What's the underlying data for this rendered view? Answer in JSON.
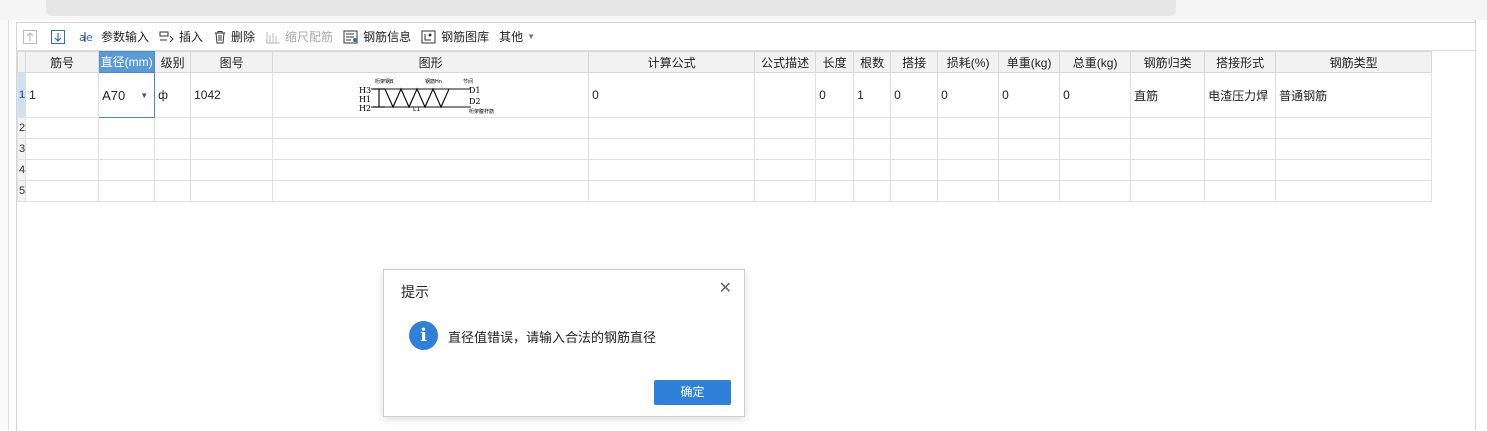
{
  "toolbar": {
    "move_up_label": "",
    "move_down_label": "",
    "param_input": "参数输入",
    "insert": "插入",
    "delete": "删除",
    "scale_rebar": "缩尺配筋",
    "rebar_info": "钢筋信息",
    "rebar_library": "钢筋图库",
    "other": "其他"
  },
  "grid": {
    "columns": [
      "筋号",
      "直径(mm)",
      "级别",
      "图号",
      "图形",
      "计算公式",
      "公式描述",
      "长度",
      "根数",
      "搭接",
      "损耗(%)",
      "单重(kg)",
      "总重(kg)",
      "钢筋归类",
      "搭接形式",
      "钢筋类型"
    ],
    "rows": [
      {
        "row_number": "1",
        "bar_no": "1",
        "diameter": "A70",
        "grade": "ф",
        "shape_no": "1042",
        "formula": "0",
        "formula_desc": "",
        "length": "0",
        "count": "1",
        "lap": "0",
        "loss": "0",
        "unit_weight": "0",
        "total_weight": "0",
        "category": "直筋",
        "lap_type": "电渣压力焊",
        "rebar_type": "普通钢筋"
      },
      {
        "row_number": "2"
      },
      {
        "row_number": "3"
      },
      {
        "row_number": "4"
      },
      {
        "row_number": "5"
      }
    ],
    "shape_labels": {
      "h3": "H3",
      "h1": "H1",
      "h2": "H2",
      "d1": "D1",
      "d2": "D2",
      "top_left": "桁架钢B",
      "top_mid": "钢筋Hn",
      "top_right": "节间",
      "bottom_mid": "L1",
      "bottom_right": "桁架腹杆筋"
    }
  },
  "dialog": {
    "title": "提示",
    "close_glyph": "✕",
    "icon": "info-icon",
    "icon_glyph": "i",
    "message": "直径值错误，请输入合法的钢筋直径",
    "ok_label": "确定",
    "accent": "#2f80d8"
  }
}
